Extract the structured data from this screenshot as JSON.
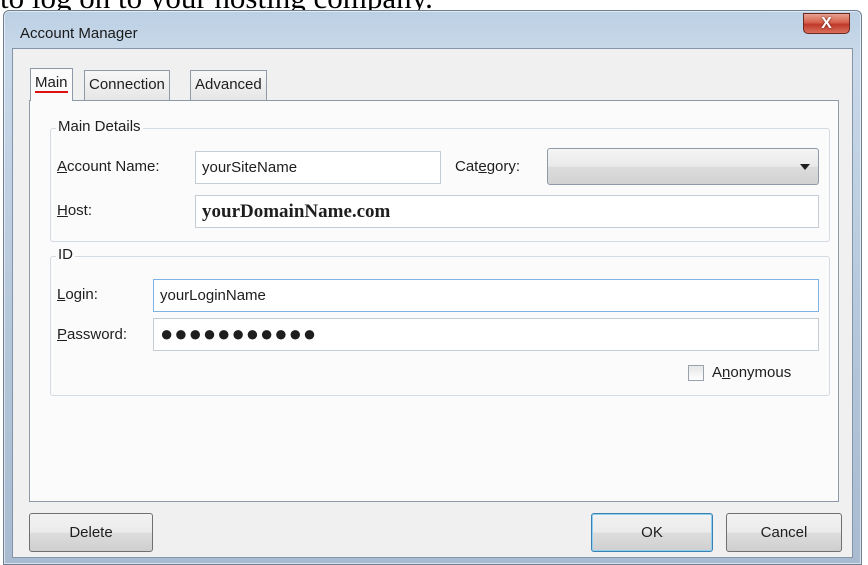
{
  "caption": "to log on to your hosting company.",
  "window": {
    "title": "Account Manager",
    "close_glyph": "X"
  },
  "tabs": [
    {
      "label": "Main",
      "active": true
    },
    {
      "label": "Connection",
      "active": false
    },
    {
      "label": "Advanced",
      "active": false
    }
  ],
  "main_details": {
    "legend": "Main Details",
    "account_name_label": {
      "pre": "",
      "key": "A",
      "post": "ccount Name:"
    },
    "account_name_value": "yourSiteName",
    "category_label": {
      "pre": "Cat",
      "key": "e",
      "post": "gory:"
    },
    "category_value": "",
    "host_label": {
      "pre": "",
      "key": "H",
      "post": "ost:"
    },
    "host_value": "yourDomainName.com"
  },
  "id_group": {
    "legend": "ID",
    "login_label": {
      "pre": "",
      "key": "L",
      "post": "ogin:"
    },
    "login_value": "yourLoginName",
    "password_label": {
      "pre": "",
      "key": "P",
      "post": "assword:"
    },
    "password_value": "●●●●●●●●●●●",
    "anonymous_label": {
      "pre": "A",
      "key": "n",
      "post": "onymous"
    },
    "anonymous_checked": false
  },
  "buttons": {
    "delete": "Delete",
    "ok": "OK",
    "cancel": "Cancel"
  },
  "colors": {
    "access_key_underline": "#dd1111",
    "close_button": "#c0392b",
    "focus_border": "#7fb4e4"
  }
}
